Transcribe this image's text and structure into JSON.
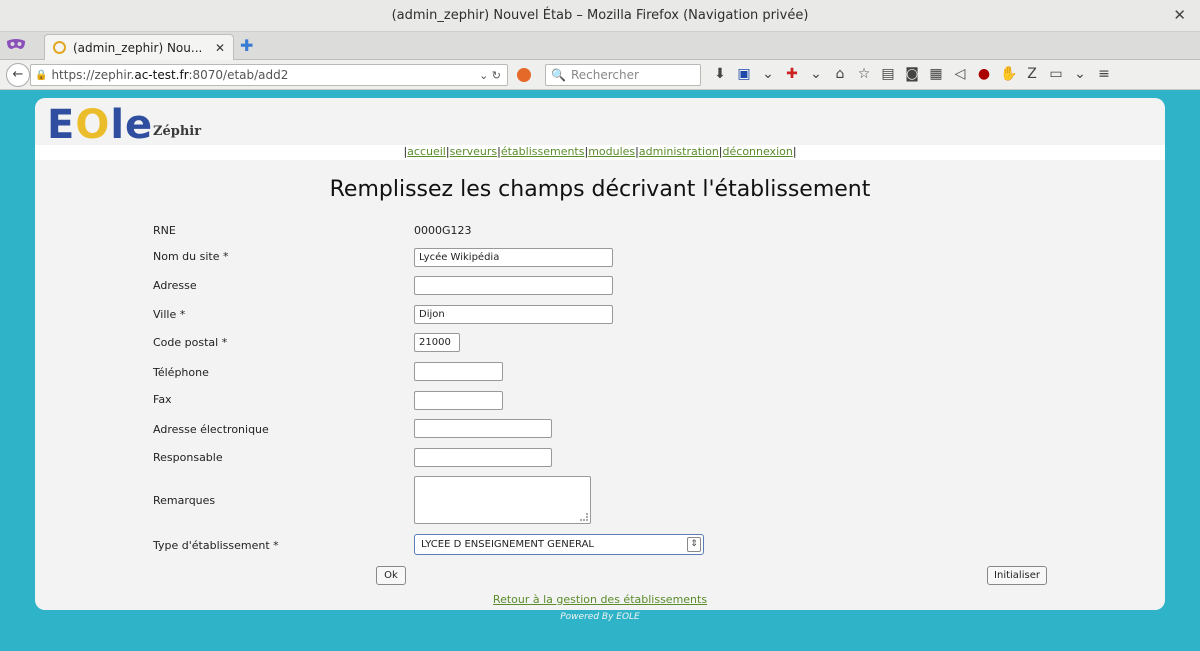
{
  "window": {
    "title": "(admin_zephir) Nouvel Étab – Mozilla Firefox (Navigation privée)"
  },
  "tab": {
    "label": "(admin_zephir) Nou..."
  },
  "nav": {
    "url_prefix": "https://zephir.",
    "url_domain": "ac-test.fr",
    "url_suffix": ":8070/etab/add2",
    "search_placeholder": "Rechercher"
  },
  "site": {
    "logo_text": "EOLE",
    "app_name": "Zéphir",
    "menu": [
      "accueil",
      "serveurs",
      "établissements",
      "modules",
      "administration",
      "déconnexion"
    ]
  },
  "form": {
    "heading": "Remplissez les champs décrivant l'établissement",
    "rne_label": "RNE",
    "rne_value": "0000G123",
    "nom_label": "Nom du site *",
    "nom_value": "Lycée Wikipédia",
    "adresse_label": "Adresse",
    "adresse_value": "",
    "ville_label": "Ville *",
    "ville_value": "Dijon",
    "cp_label": "Code postal *",
    "cp_value": "21000",
    "tel_label": "Téléphone",
    "tel_value": "",
    "fax_label": "Fax",
    "fax_value": "",
    "mail_label": "Adresse électronique",
    "mail_value": "",
    "resp_label": "Responsable",
    "resp_value": "",
    "remarques_label": "Remarques",
    "type_label": "Type d'établissement *",
    "type_value": "LYCEE D ENSEIGNEMENT GENERAL",
    "ok_label": "Ok",
    "reset_label": "Initialiser"
  },
  "footer": {
    "back_link": "Retour à la gestion des établissements",
    "powered": "Powered By EOLE"
  },
  "colors": {
    "background": "#2eb3c8",
    "link": "#5a8c2a",
    "logo_blue": "#2f4e9f",
    "logo_yellow": "#ecbd2a"
  }
}
